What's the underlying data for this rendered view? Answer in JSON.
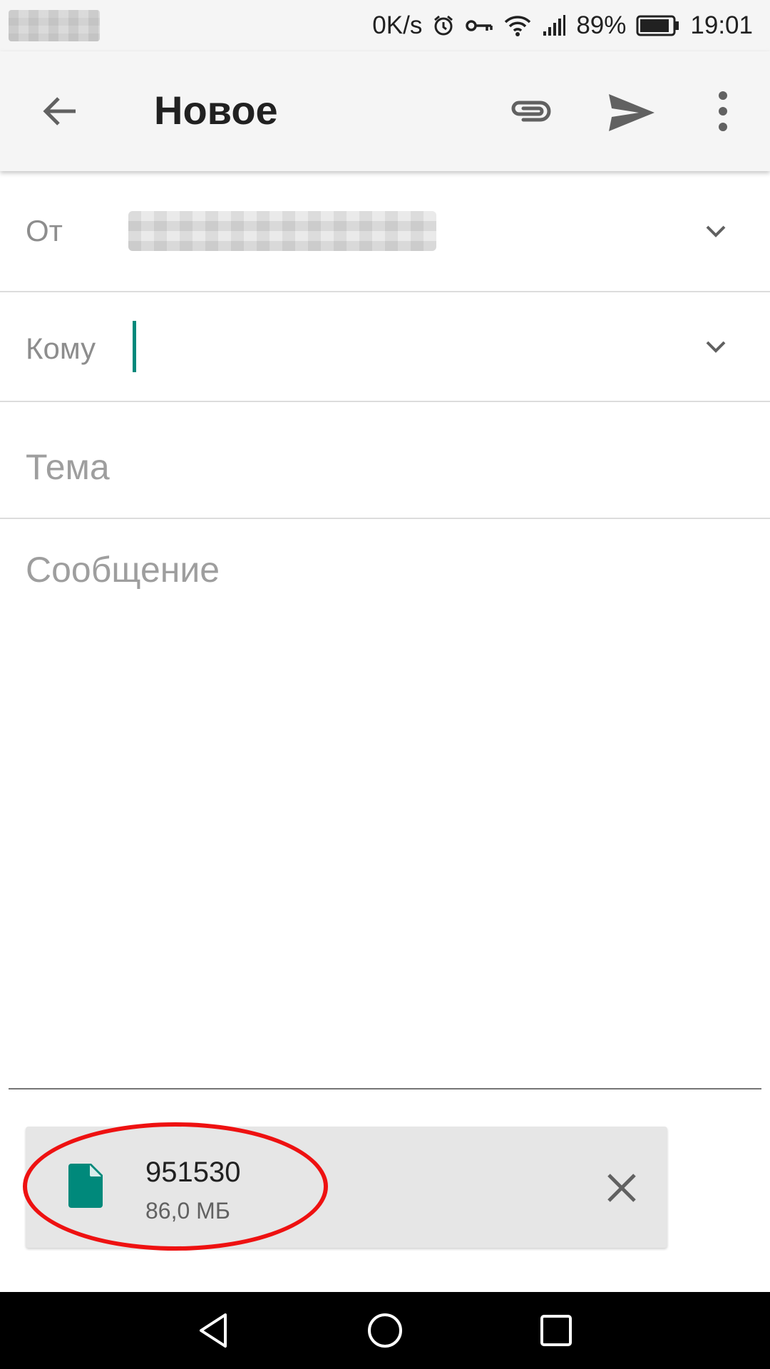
{
  "status_bar": {
    "net_speed": "0K/s",
    "battery_percent": "89%",
    "time": "19:01",
    "icons": [
      "alarm-icon",
      "vpn-key-icon",
      "wifi-icon",
      "signal-icon",
      "battery-icon"
    ]
  },
  "app_bar": {
    "title": "Новое",
    "icons": [
      "back-arrow-icon",
      "attach-icon",
      "send-icon",
      "more-vert-icon"
    ]
  },
  "compose": {
    "from_label": "От",
    "to_label": "Кому",
    "subject_placeholder": "Тема",
    "body_placeholder": "Сообщение"
  },
  "attachment": {
    "name": "951530",
    "size": "86,0 МБ",
    "icon": "file-icon",
    "remove_icon": "close-icon"
  },
  "colors": {
    "accent": "#00897b",
    "highlight": "#ee1111",
    "app_bar_bg": "#f5f5f5"
  },
  "nav_bar": {
    "icons": [
      "nav-back-icon",
      "nav-home-icon",
      "nav-recents-icon"
    ]
  }
}
